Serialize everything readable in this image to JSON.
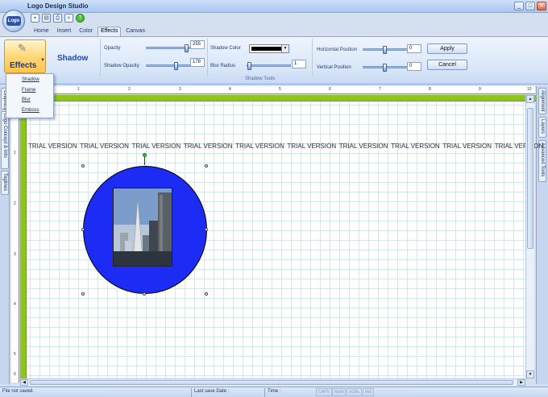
{
  "window": {
    "title": "Logo Design Studio",
    "logo_text": "Logo",
    "controls": {
      "minimize": "_",
      "maximize": "□",
      "close": "✕"
    }
  },
  "quick_access": [
    {
      "icon": "save-icon",
      "glyph": "▪"
    },
    {
      "icon": "export-icon",
      "glyph": "▤"
    },
    {
      "icon": "print-icon",
      "glyph": "⎙"
    },
    {
      "icon": "preview-icon",
      "glyph": "⌕"
    },
    {
      "icon": "help-icon",
      "glyph": "?"
    }
  ],
  "tabs": [
    {
      "label": "Home",
      "active": false
    },
    {
      "label": "Insert",
      "active": false
    },
    {
      "label": "Color",
      "active": false
    },
    {
      "label": "Effects",
      "active": true
    },
    {
      "label": "Canvas",
      "active": false
    }
  ],
  "ribbon": {
    "effects_button": "Effects",
    "section_title": "Shadow",
    "opacity_label": "Opacity",
    "opacity_value": "255",
    "opacity_fraction": 1.0,
    "shadow_opacity_label": "Shadow Opacity",
    "shadow_opacity_value": "178",
    "shadow_opacity_fraction": 0.7,
    "shadow_color_label": "Shadow Color",
    "shadow_color": "#000000",
    "blur_radius_label": "Blur Radius",
    "blur_radius_value": "1",
    "blur_fraction": 0.05,
    "horizontal_position_label": "Horizontal Position",
    "horizontal_position_value": "0",
    "horizontal_fraction": 0.5,
    "vertical_position_label": "Vertical Position",
    "vertical_position_value": "0",
    "vertical_fraction": 0.5,
    "apply_label": "Apply",
    "cancel_label": "Cancel",
    "group_caption": "Shadow Tools"
  },
  "effects_menu": [
    "Shadow",
    "Frame",
    "Blur",
    "Emboss"
  ],
  "left_tabs": [
    "Graphics",
    "Logo Concept & Info",
    "Taglines"
  ],
  "right_tabs": [
    "Alignment",
    "Layers",
    "Advanced Tools"
  ],
  "rulers": {
    "top": [
      "1",
      "2",
      "3",
      "4",
      "5",
      "6",
      "7",
      "8",
      "9",
      "10"
    ],
    "left": [
      "1",
      "2",
      "3",
      "4",
      "5",
      "6"
    ]
  },
  "canvas": {
    "watermark": "TRIAL VERSION",
    "watermark_count": 10,
    "background": "#ffffff",
    "grid_color": "#cfe8ee",
    "border_color": "#8fc420",
    "circle_color": "#1c2cf5"
  },
  "status": {
    "file_state": "File not saved.",
    "last_save": "Last save Date :",
    "time": "Time :",
    "indicators": [
      "CAPS",
      "NUM",
      "SCRL",
      "INS"
    ]
  }
}
